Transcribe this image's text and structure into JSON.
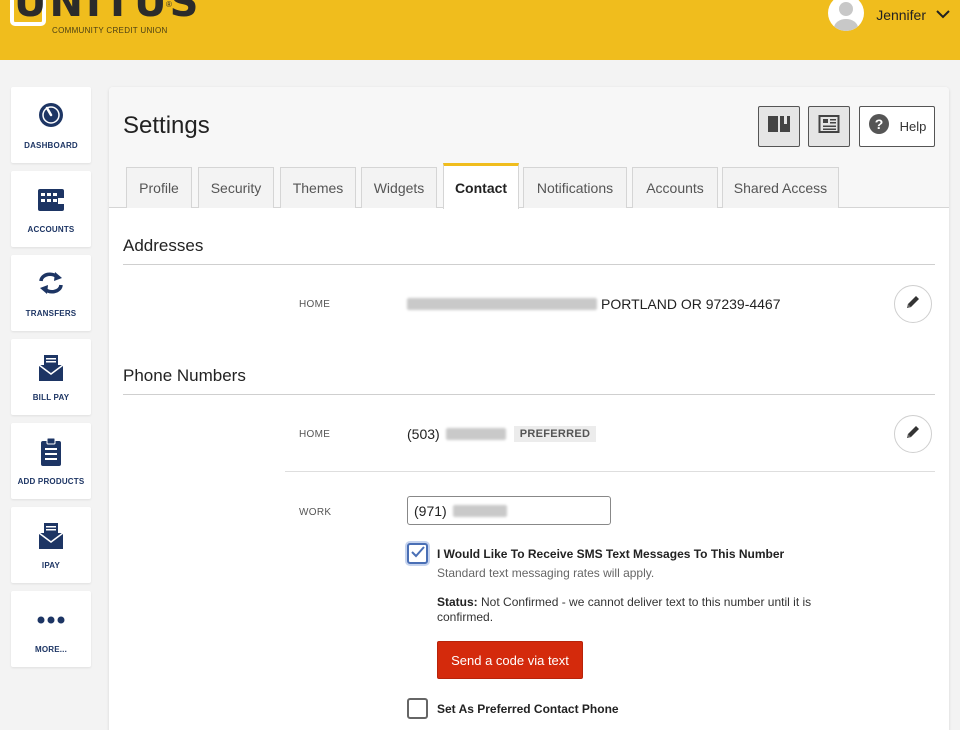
{
  "header": {
    "logo_text": "UNITUS",
    "logo_reg": "®",
    "logo_subtitle": "COMMUNITY CREDIT UNION",
    "user_name": "Jennifer",
    "brand_color": "#f0bd1d"
  },
  "sidebar": {
    "items": [
      {
        "label": "DASHBOARD",
        "icon": "gauge-icon"
      },
      {
        "label": "ACCOUNTS",
        "icon": "wallet-icon"
      },
      {
        "label": "TRANSFERS",
        "icon": "transfer-arrows-icon"
      },
      {
        "label": "BILL PAY",
        "icon": "envelope-icon"
      },
      {
        "label": "ADD PRODUCTS",
        "icon": "clipboard-icon"
      },
      {
        "label": "IPAY",
        "icon": "envelope-icon"
      },
      {
        "label": "MORE...",
        "icon": "dots-icon"
      }
    ]
  },
  "settings": {
    "title": "Settings",
    "help_label": "Help",
    "tabs": [
      {
        "label": "Profile",
        "active": false
      },
      {
        "label": "Security",
        "active": false
      },
      {
        "label": "Themes",
        "active": false
      },
      {
        "label": "Widgets",
        "active": false
      },
      {
        "label": "Contact",
        "active": true
      },
      {
        "label": "Notifications",
        "active": false
      },
      {
        "label": "Accounts",
        "active": false
      },
      {
        "label": "Shared Access",
        "active": false
      }
    ]
  },
  "addresses": {
    "title": "Addresses",
    "home_label": "HOME",
    "home_value": "PORTLAND OR 97239-4467"
  },
  "phones": {
    "title": "Phone Numbers",
    "home_label": "HOME",
    "home_area": "(503)",
    "home_badge": "PREFERRED",
    "work_label": "WORK",
    "work_area": "(971)",
    "sms_title": "I Would Like To Receive SMS Text Messages To This Number",
    "sms_subtitle": "Standard text messaging rates will apply.",
    "sms_checked": true,
    "status_label": "Status:",
    "status_text": "Not Confirmed - we cannot deliver text to this number until it is confirmed.",
    "send_button": "Send a code via text",
    "send_button_color": "#d42a0c",
    "preferred_label": "Set As Preferred Contact Phone",
    "preferred_checked": false
  }
}
